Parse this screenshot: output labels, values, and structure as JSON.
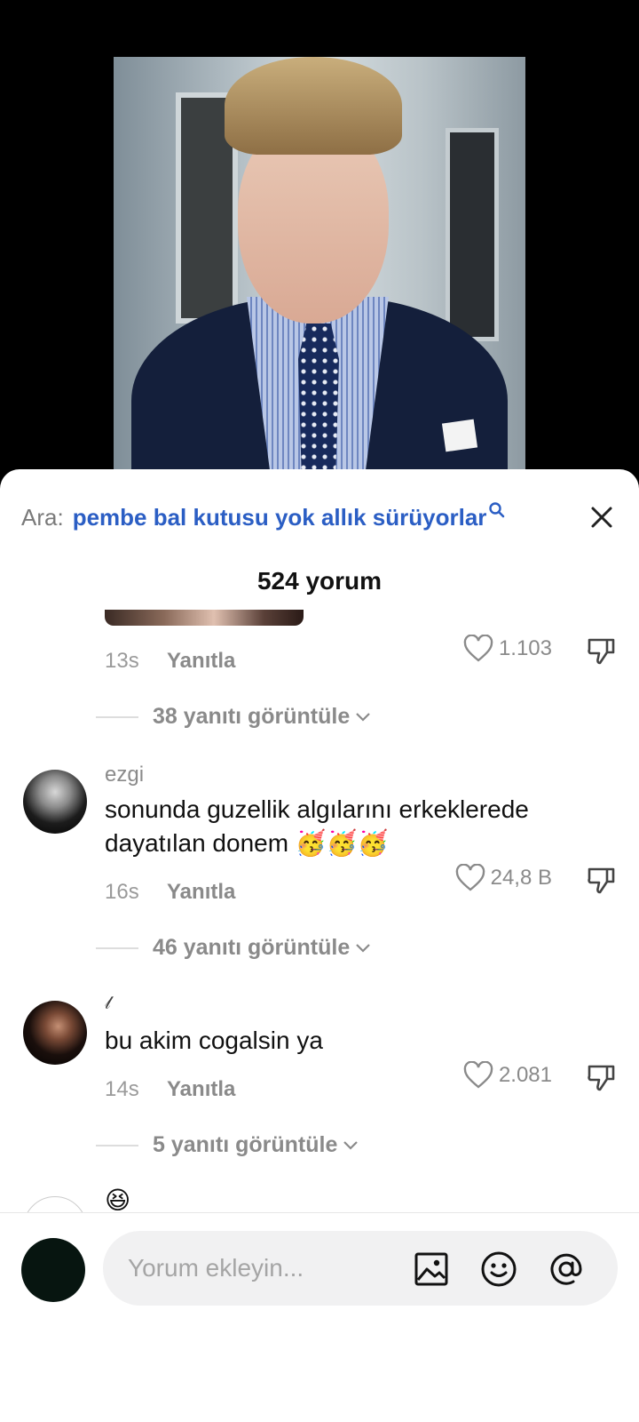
{
  "search": {
    "label": "Ara:",
    "query": "pembe bal kutusu yok allık sürüyorlar"
  },
  "comments_header": {
    "count_label": "524 yorum"
  },
  "comments": [
    {
      "time": "13s",
      "reply_label": "Yanıtla",
      "likes": "1.103",
      "view_replies": "38 yanıtı görüntüle"
    },
    {
      "username": "ezgi",
      "text_line1": "sonunda guzellik algılarını erkeklerede",
      "text_line2": "dayatılan donem",
      "emoji": "🥳🥳🥳",
      "time": "16s",
      "reply_label": "Yanıtla",
      "likes": "24,8 B",
      "view_replies": "46 yanıtı görüntüle"
    },
    {
      "username": "𝓁",
      "text": "bu akim cogalsin ya",
      "time": "14s",
      "reply_label": "Yanıtla",
      "likes": "2.081",
      "view_replies": "5 yanıtı görüntüle"
    },
    {
      "text": "😆"
    }
  ],
  "composer": {
    "placeholder": "Yorum ekleyin..."
  },
  "colors": {
    "accent": "#2b5ec4",
    "muted": "#8a8a8a",
    "input_bg": "#f1f1f2"
  }
}
